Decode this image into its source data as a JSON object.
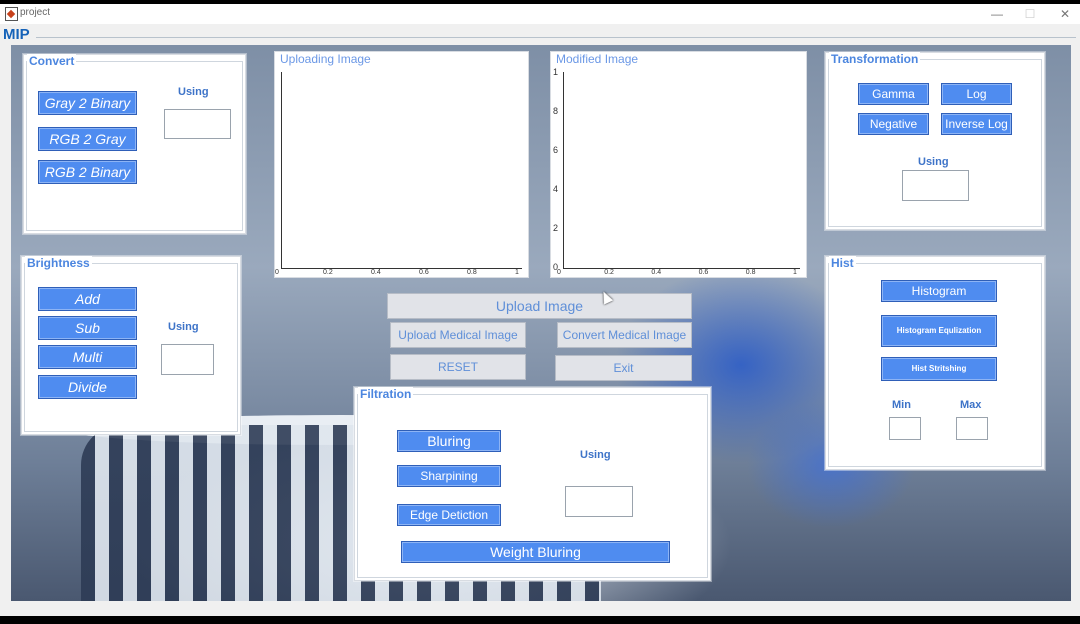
{
  "window": {
    "title": "project",
    "minimize": "—",
    "maximize": "☐",
    "close": "✕"
  },
  "app_label": "MIP",
  "convert": {
    "title": "Convert",
    "using": "Using",
    "buttons": [
      "Gray 2 Binary",
      "RGB 2 Gray",
      "RGB 2 Binary"
    ]
  },
  "brightness": {
    "title": "Brightness",
    "using": "Using",
    "buttons": [
      "Add",
      "Sub",
      "Multi",
      "Divide"
    ]
  },
  "uploading_axes": {
    "title": "Uploading Image"
  },
  "modified_axes": {
    "title": "Modified Image",
    "y_ticks": [
      "1",
      "8",
      "6",
      "4",
      "2",
      "0"
    ],
    "x_ticks": [
      "0",
      "0.2",
      "0.4",
      "0.6",
      "0.8",
      "1"
    ]
  },
  "transformation": {
    "title": "Transformation",
    "using": "Using",
    "buttons": [
      "Gamma",
      "Log",
      "Negative",
      "Inverse Log"
    ]
  },
  "hist": {
    "title": "Hist",
    "buttons": [
      "Histogram",
      "Histogram Equlization",
      "Hist Stritshing"
    ],
    "min": "Min",
    "max": "Max"
  },
  "center": {
    "upload": "Upload Image",
    "upload_medical": "Upload Medical Image",
    "convert_medical": "Convert Medical Image",
    "reset": "RESET",
    "exit": "Exit"
  },
  "filtration": {
    "title": "Filtration",
    "using": "Using",
    "buttons": [
      "Bluring",
      "Sharpining",
      "Edge Detiction"
    ],
    "weight": "Weight Bluring"
  },
  "colors": {
    "accent_button": "#4f8cf0",
    "title_text": "#4c86df",
    "gray_button": "#e1e3e8"
  }
}
